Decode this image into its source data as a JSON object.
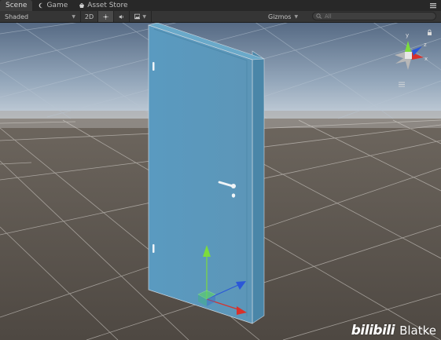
{
  "tabs": [
    {
      "label": "Scene",
      "icon": "scene-icon",
      "active": true
    },
    {
      "label": "Game",
      "icon": "game-icon",
      "active": false
    },
    {
      "label": "Asset Store",
      "icon": "asset-store-icon",
      "active": false
    }
  ],
  "toolbar": {
    "shading_mode": "Shaded",
    "mode_2d": "2D",
    "gizmos_label": "Gizmos",
    "search_placeholder": "All"
  },
  "scene": {
    "orientation_labels": {
      "y": "y",
      "x": "x",
      "z": "z"
    },
    "selected_object": "door"
  },
  "watermark": {
    "logo": "bilibili",
    "name": "Blatke"
  },
  "colors": {
    "sky_top": "#5a6e86",
    "sky_horizon": "#c9d3dc",
    "ground": "#5b544c",
    "door": "#5f9dbf",
    "gizmo_y": "#7ddc3c",
    "gizmo_z": "#2b57d8",
    "gizmo_x": "#d8312b"
  }
}
